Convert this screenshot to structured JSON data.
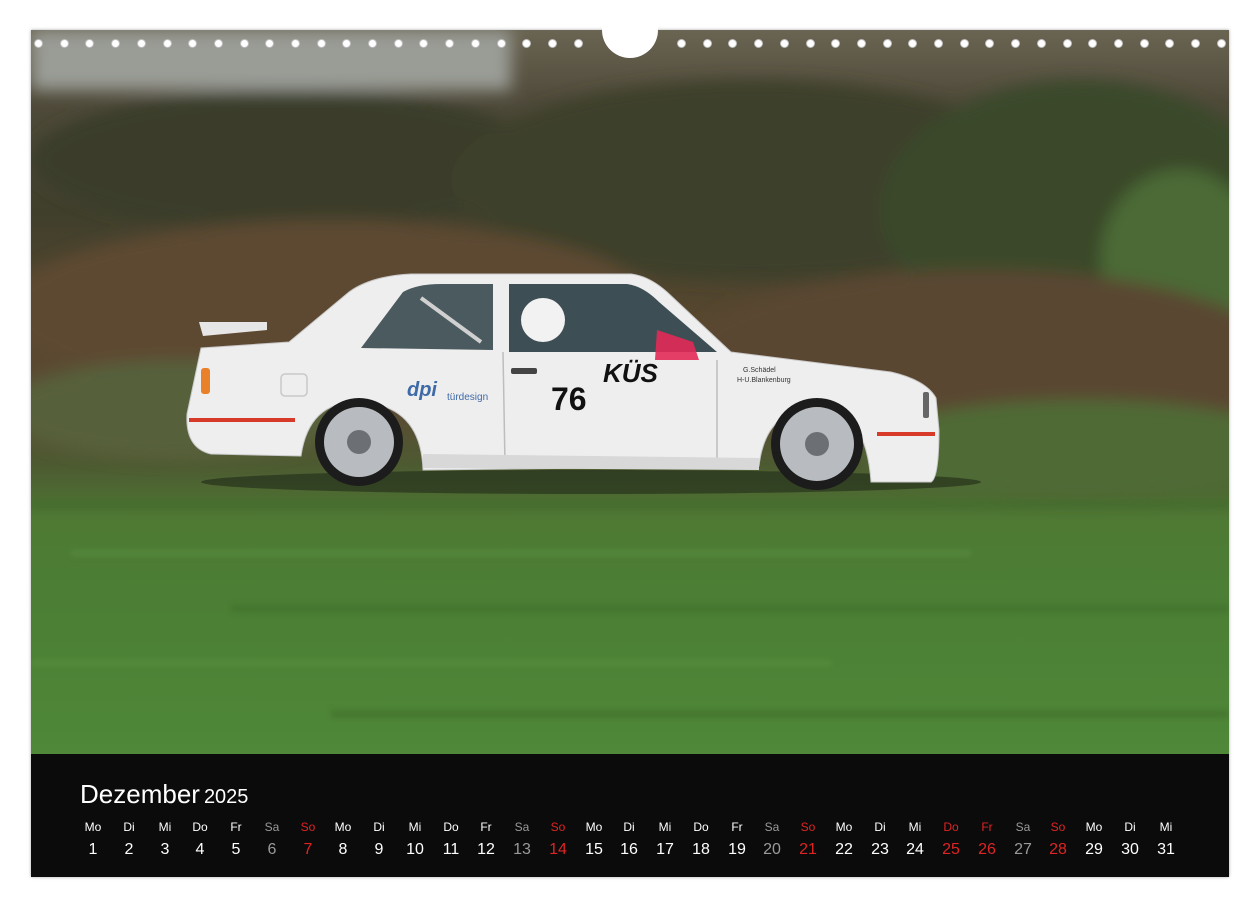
{
  "calendar": {
    "month": "Dezember",
    "year": "2025",
    "days": [
      {
        "dow": "Mo",
        "num": "1",
        "type": "weekday"
      },
      {
        "dow": "Di",
        "num": "2",
        "type": "weekday"
      },
      {
        "dow": "Mi",
        "num": "3",
        "type": "weekday"
      },
      {
        "dow": "Do",
        "num": "4",
        "type": "weekday"
      },
      {
        "dow": "Fr",
        "num": "5",
        "type": "weekday"
      },
      {
        "dow": "Sa",
        "num": "6",
        "type": "saturday"
      },
      {
        "dow": "So",
        "num": "7",
        "type": "sunday"
      },
      {
        "dow": "Mo",
        "num": "8",
        "type": "weekday"
      },
      {
        "dow": "Di",
        "num": "9",
        "type": "weekday"
      },
      {
        "dow": "Mi",
        "num": "10",
        "type": "weekday"
      },
      {
        "dow": "Do",
        "num": "11",
        "type": "weekday"
      },
      {
        "dow": "Fr",
        "num": "12",
        "type": "weekday"
      },
      {
        "dow": "Sa",
        "num": "13",
        "type": "saturday"
      },
      {
        "dow": "So",
        "num": "14",
        "type": "sunday"
      },
      {
        "dow": "Mo",
        "num": "15",
        "type": "weekday"
      },
      {
        "dow": "Di",
        "num": "16",
        "type": "weekday"
      },
      {
        "dow": "Mi",
        "num": "17",
        "type": "weekday"
      },
      {
        "dow": "Do",
        "num": "18",
        "type": "weekday"
      },
      {
        "dow": "Fr",
        "num": "19",
        "type": "weekday"
      },
      {
        "dow": "Sa",
        "num": "20",
        "type": "saturday"
      },
      {
        "dow": "So",
        "num": "21",
        "type": "sunday"
      },
      {
        "dow": "Mo",
        "num": "22",
        "type": "weekday"
      },
      {
        "dow": "Di",
        "num": "23",
        "type": "weekday"
      },
      {
        "dow": "Mi",
        "num": "24",
        "type": "weekday"
      },
      {
        "dow": "Do",
        "num": "25",
        "type": "holiday"
      },
      {
        "dow": "Fr",
        "num": "26",
        "type": "holiday"
      },
      {
        "dow": "Sa",
        "num": "27",
        "type": "saturday"
      },
      {
        "dow": "So",
        "num": "28",
        "type": "sunday"
      },
      {
        "dow": "Mo",
        "num": "29",
        "type": "weekday"
      },
      {
        "dow": "Di",
        "num": "30",
        "type": "weekday"
      },
      {
        "dow": "Mi",
        "num": "31",
        "type": "weekday"
      }
    ]
  },
  "photo": {
    "car_sponsor": "KÜS",
    "car_number": "76",
    "logo_text": "dpi",
    "logo_subtext": "türdesign",
    "driver_names": [
      "G.Schädel",
      "H-U.Blankenburg"
    ]
  },
  "colors": {
    "weekday": "#ffffff",
    "saturday": "#9a9a9a",
    "sunday": "#e02424",
    "holiday": "#e02424",
    "calendar_bg": "#0b0b0b",
    "car_body": "#eeeeee"
  }
}
